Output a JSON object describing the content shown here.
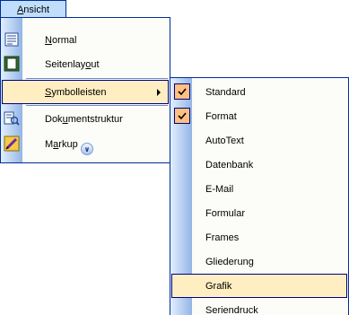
{
  "menubar": {
    "label": "Ansicht"
  },
  "view_menu": {
    "items": [
      {
        "label": "Normal",
        "icon": "normal-view-icon"
      },
      {
        "label": "Seitenlayout",
        "icon": "page-layout-icon"
      },
      {
        "label": "Symbolleisten",
        "icon": "",
        "submenu": true,
        "highlighted": true
      },
      {
        "label": "Dokumentstruktur",
        "icon": "document-map-icon"
      },
      {
        "label": "Markup",
        "icon": "markup-icon"
      }
    ],
    "expand_icon": "chevron-double-down-icon"
  },
  "toolbars_submenu": {
    "items": [
      {
        "label": "Standard",
        "checked": true
      },
      {
        "label": "Format",
        "checked": true
      },
      {
        "label": "AutoText",
        "checked": false
      },
      {
        "label": "Datenbank",
        "checked": false
      },
      {
        "label": "E-Mail",
        "checked": false
      },
      {
        "label": "Formular",
        "checked": false
      },
      {
        "label": "Frames",
        "checked": false
      },
      {
        "label": "Gliederung",
        "checked": false
      },
      {
        "label": "Grafik",
        "checked": false,
        "highlighted": true
      },
      {
        "label": "Seriendruck",
        "checked": false
      }
    ]
  },
  "colors": {
    "highlight_bg": "#ffeec2",
    "highlight_border": "#000080",
    "menu_border": "#002d96",
    "gutter_start": "#e3efff",
    "gutter_end": "#93b5e6",
    "check_bg": "#ffc080"
  }
}
